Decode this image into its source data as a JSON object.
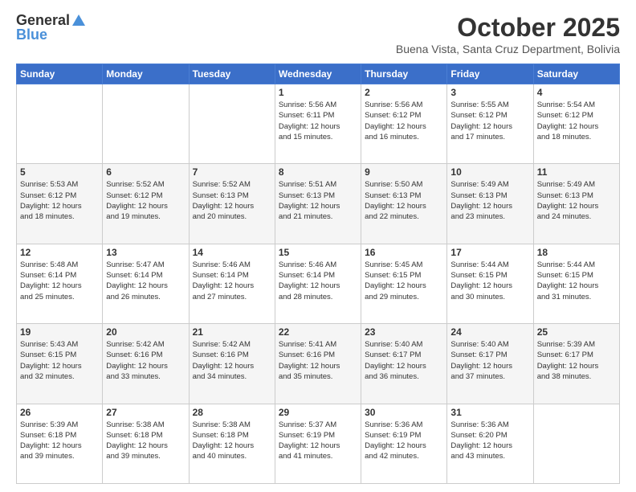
{
  "logo": {
    "line1": "General",
    "line2": "Blue"
  },
  "header": {
    "month": "October 2025",
    "location": "Buena Vista, Santa Cruz Department, Bolivia"
  },
  "days_of_week": [
    "Sunday",
    "Monday",
    "Tuesday",
    "Wednesday",
    "Thursday",
    "Friday",
    "Saturday"
  ],
  "weeks": [
    [
      {
        "day": "",
        "info": ""
      },
      {
        "day": "",
        "info": ""
      },
      {
        "day": "",
        "info": ""
      },
      {
        "day": "1",
        "info": "Sunrise: 5:56 AM\nSunset: 6:11 PM\nDaylight: 12 hours\nand 15 minutes."
      },
      {
        "day": "2",
        "info": "Sunrise: 5:56 AM\nSunset: 6:12 PM\nDaylight: 12 hours\nand 16 minutes."
      },
      {
        "day": "3",
        "info": "Sunrise: 5:55 AM\nSunset: 6:12 PM\nDaylight: 12 hours\nand 17 minutes."
      },
      {
        "day": "4",
        "info": "Sunrise: 5:54 AM\nSunset: 6:12 PM\nDaylight: 12 hours\nand 18 minutes."
      }
    ],
    [
      {
        "day": "5",
        "info": "Sunrise: 5:53 AM\nSunset: 6:12 PM\nDaylight: 12 hours\nand 18 minutes."
      },
      {
        "day": "6",
        "info": "Sunrise: 5:52 AM\nSunset: 6:12 PM\nDaylight: 12 hours\nand 19 minutes."
      },
      {
        "day": "7",
        "info": "Sunrise: 5:52 AM\nSunset: 6:13 PM\nDaylight: 12 hours\nand 20 minutes."
      },
      {
        "day": "8",
        "info": "Sunrise: 5:51 AM\nSunset: 6:13 PM\nDaylight: 12 hours\nand 21 minutes."
      },
      {
        "day": "9",
        "info": "Sunrise: 5:50 AM\nSunset: 6:13 PM\nDaylight: 12 hours\nand 22 minutes."
      },
      {
        "day": "10",
        "info": "Sunrise: 5:49 AM\nSunset: 6:13 PM\nDaylight: 12 hours\nand 23 minutes."
      },
      {
        "day": "11",
        "info": "Sunrise: 5:49 AM\nSunset: 6:13 PM\nDaylight: 12 hours\nand 24 minutes."
      }
    ],
    [
      {
        "day": "12",
        "info": "Sunrise: 5:48 AM\nSunset: 6:14 PM\nDaylight: 12 hours\nand 25 minutes."
      },
      {
        "day": "13",
        "info": "Sunrise: 5:47 AM\nSunset: 6:14 PM\nDaylight: 12 hours\nand 26 minutes."
      },
      {
        "day": "14",
        "info": "Sunrise: 5:46 AM\nSunset: 6:14 PM\nDaylight: 12 hours\nand 27 minutes."
      },
      {
        "day": "15",
        "info": "Sunrise: 5:46 AM\nSunset: 6:14 PM\nDaylight: 12 hours\nand 28 minutes."
      },
      {
        "day": "16",
        "info": "Sunrise: 5:45 AM\nSunset: 6:15 PM\nDaylight: 12 hours\nand 29 minutes."
      },
      {
        "day": "17",
        "info": "Sunrise: 5:44 AM\nSunset: 6:15 PM\nDaylight: 12 hours\nand 30 minutes."
      },
      {
        "day": "18",
        "info": "Sunrise: 5:44 AM\nSunset: 6:15 PM\nDaylight: 12 hours\nand 31 minutes."
      }
    ],
    [
      {
        "day": "19",
        "info": "Sunrise: 5:43 AM\nSunset: 6:15 PM\nDaylight: 12 hours\nand 32 minutes."
      },
      {
        "day": "20",
        "info": "Sunrise: 5:42 AM\nSunset: 6:16 PM\nDaylight: 12 hours\nand 33 minutes."
      },
      {
        "day": "21",
        "info": "Sunrise: 5:42 AM\nSunset: 6:16 PM\nDaylight: 12 hours\nand 34 minutes."
      },
      {
        "day": "22",
        "info": "Sunrise: 5:41 AM\nSunset: 6:16 PM\nDaylight: 12 hours\nand 35 minutes."
      },
      {
        "day": "23",
        "info": "Sunrise: 5:40 AM\nSunset: 6:17 PM\nDaylight: 12 hours\nand 36 minutes."
      },
      {
        "day": "24",
        "info": "Sunrise: 5:40 AM\nSunset: 6:17 PM\nDaylight: 12 hours\nand 37 minutes."
      },
      {
        "day": "25",
        "info": "Sunrise: 5:39 AM\nSunset: 6:17 PM\nDaylight: 12 hours\nand 38 minutes."
      }
    ],
    [
      {
        "day": "26",
        "info": "Sunrise: 5:39 AM\nSunset: 6:18 PM\nDaylight: 12 hours\nand 39 minutes."
      },
      {
        "day": "27",
        "info": "Sunrise: 5:38 AM\nSunset: 6:18 PM\nDaylight: 12 hours\nand 39 minutes."
      },
      {
        "day": "28",
        "info": "Sunrise: 5:38 AM\nSunset: 6:18 PM\nDaylight: 12 hours\nand 40 minutes."
      },
      {
        "day": "29",
        "info": "Sunrise: 5:37 AM\nSunset: 6:19 PM\nDaylight: 12 hours\nand 41 minutes."
      },
      {
        "day": "30",
        "info": "Sunrise: 5:36 AM\nSunset: 6:19 PM\nDaylight: 12 hours\nand 42 minutes."
      },
      {
        "day": "31",
        "info": "Sunrise: 5:36 AM\nSunset: 6:20 PM\nDaylight: 12 hours\nand 43 minutes."
      },
      {
        "day": "",
        "info": ""
      }
    ]
  ]
}
